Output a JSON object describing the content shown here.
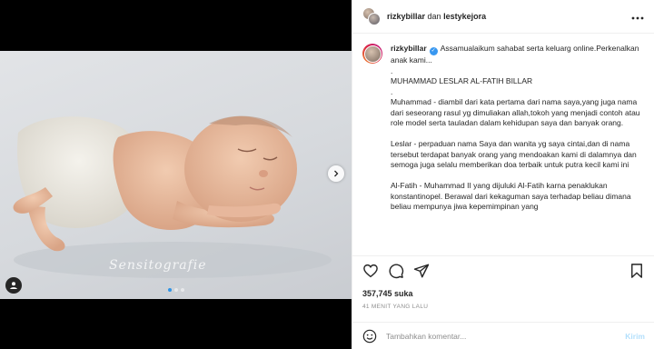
{
  "colors": {
    "accent": "#0095f6",
    "post_disabled": "#b2dffc",
    "muted": "#8e8e8e",
    "text": "#262626",
    "verified": "#3897f0"
  },
  "media": {
    "watermark": "Sensitografie",
    "carousel": {
      "count": 3,
      "active": 0
    },
    "icons": {
      "next": "chevron-right-icon",
      "tag": "user-tag-icon"
    }
  },
  "header": {
    "user1": "rizkybillar",
    "joiner": "dan",
    "user2": "lestykejora",
    "more_icon": "more-horizontal-icon"
  },
  "caption": {
    "username": "rizkybillar",
    "lines": [
      "Assamualaikum sahabat serta keluarg online.Perkenalkan anak kami...",
      ".",
      "MUHAMMAD LESLAR AL-FATIH BILLAR",
      ".",
      "Muhammad - diambil dari kata pertama dari nama saya,yang juga nama dari seseorang rasul yg dimuliakan allah,tokoh yang menjadi contoh atau role model serta tauladan dalam kehidupan saya dan banyak orang.",
      "",
      "Leslar - perpaduan nama Saya dan wanita yg saya cintai,dan di nama tersebut terdapat banyak orang yang mendoakan kami di dalamnya dan semoga juga selalu memberikan doa terbaik untuk putra kecil kami ini",
      "",
      "Al-Fatih - Muhammad II yang dijuluki Al-Fatih karna penaklukan konstantinopel. Berawal dari kekaguman saya terhadap beliau dimana beliau mempunya jiwa kepemimpinan yang"
    ]
  },
  "actions": {
    "icons": [
      "heart-icon",
      "comment-icon",
      "share-icon",
      "save-icon"
    ],
    "likes": "357,745 suka",
    "time_ago": "41 MENIT YANG LALU"
  },
  "comment": {
    "emoji_icon": "emoji-icon",
    "placeholder": "Tambahkan komentar...",
    "post_label": "Kirim"
  }
}
